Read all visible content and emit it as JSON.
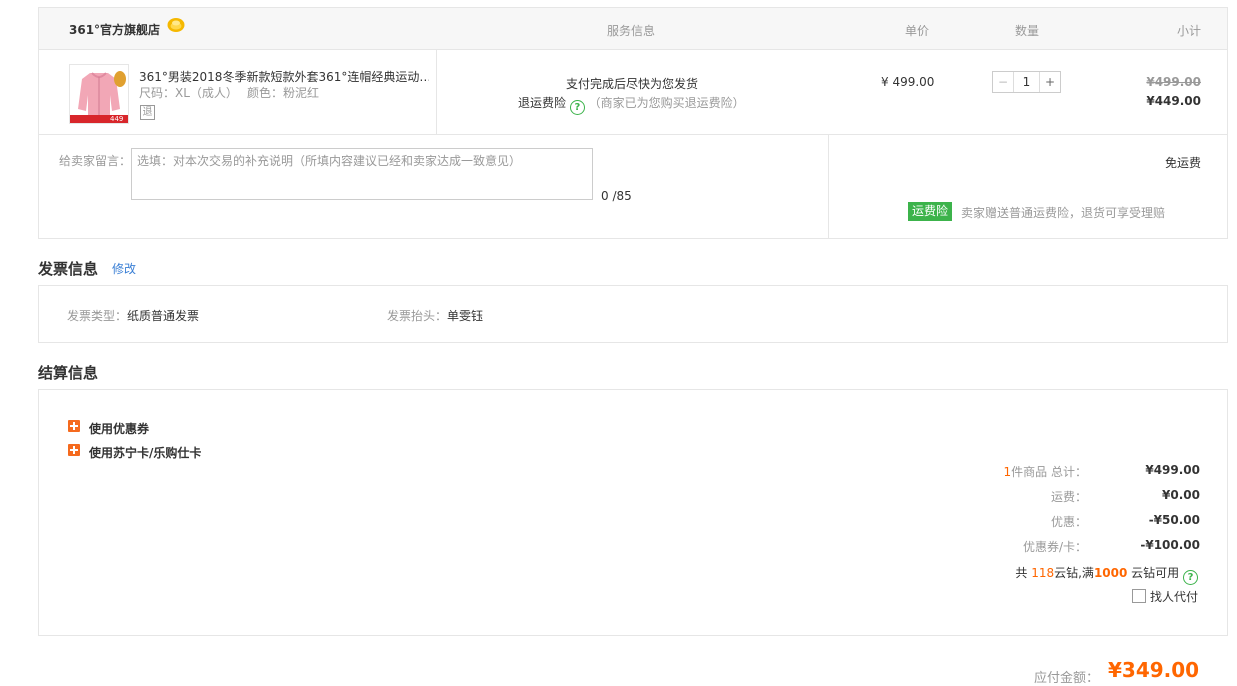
{
  "store": {
    "name": "361°官方旗舰店"
  },
  "headers": {
    "service": "服务信息",
    "price": "单价",
    "quantity": "数量",
    "subtotal": "小计"
  },
  "item": {
    "title": "361°男装2018冬季新款短款外套361°连帽经典运动…",
    "size": "尺码：XL（成人）",
    "color": "颜色：粉泥红",
    "return_badge": "退",
    "thumb_caption": "449",
    "service_line1": "支付完成后尽快为您发货",
    "insurance_label": "退运费险",
    "insurance_help": "?",
    "insurance_note": "（商家已为您购买退运费险）",
    "unit_price": "¥ 499.00",
    "qty_minus": "−",
    "qty_value": "1",
    "qty_plus": "+",
    "original_subtotal": "¥499.00",
    "subtotal": "¥449.00"
  },
  "message": {
    "label": "给卖家留言：",
    "placeholder": "选填：对本次交易的补充说明（所填内容建议已经和卖家达成一致意见）",
    "counter": "0 /85"
  },
  "shipping": {
    "free_label": "免运费",
    "badge": "运费险",
    "note": "卖家赠送普通运费险，退货可享受理赔"
  },
  "invoice": {
    "section_title": "发票信息",
    "edit_link": "修改",
    "type_label": "发票类型：",
    "type_value": "纸质普通发票",
    "header_label": "发票抬头：",
    "header_value": "单雯钰"
  },
  "settlement": {
    "section_title": "结算信息",
    "coupon_label": "使用优惠券",
    "card_label": "使用苏宁卡/乐购仕卡",
    "count_num": "1",
    "count_label": "件商品 总计：",
    "total_value": "¥499.00",
    "freight_label": "运费：",
    "freight_value": "¥0.00",
    "discount_label": "优惠：",
    "discount_value": "-¥50.00",
    "coupon_card_label": "优惠券/卡：",
    "coupon_card_value": "-¥100.00",
    "diamond_prefix": "共 ",
    "diamond_count": "118",
    "diamond_mid": "云钻,满",
    "diamond_threshold": "1000",
    "diamond_suffix": " 云钻可用",
    "diamond_help": "?",
    "proxy_pay_label": "找人代付"
  },
  "payable": {
    "label": "应付金额：",
    "amount": "¥349.00"
  }
}
